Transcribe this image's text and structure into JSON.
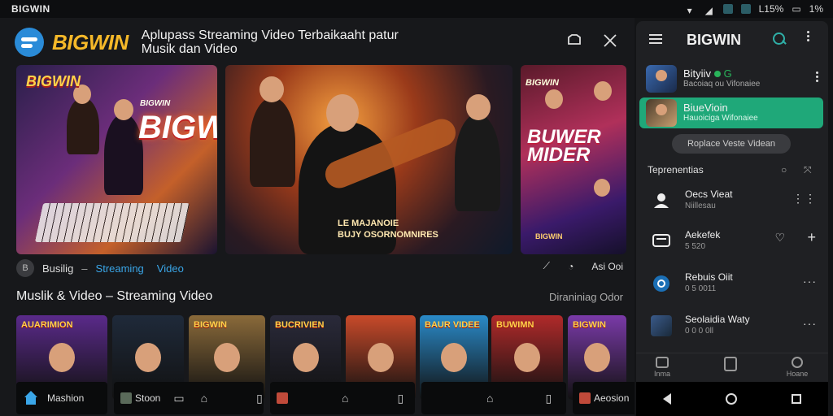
{
  "statusbar": {
    "left_label": "BIGWIN",
    "battery": "L15%",
    "signal": "1%"
  },
  "header": {
    "brand": "BIGWIN",
    "title": "Aplupass Streaming Video Terbaikaaht patur Musik dan Video"
  },
  "featured": [
    {
      "small_title": "BIGWIN",
      "sub": "BIGWIN",
      "big_title": "BIGWIN"
    },
    {
      "caption": "LE MAJANOIE\nBUJY OSORNOMNIRES"
    },
    {
      "top_title": "BIGWIN",
      "big_title": "BUWER\nMIDER",
      "footer": "BIGWIN"
    }
  ],
  "tags": {
    "icon_label": "B",
    "items": [
      "Busilig",
      "–",
      "Streaming",
      "Video"
    ],
    "right_label": "Asi Ooi"
  },
  "section": {
    "title": "Muslik & Video – Streaming Video",
    "more_label": "Diraniniag Odor"
  },
  "thumbnails": [
    {
      "label": "AUARIMION",
      "bg": "#5a2a8a"
    },
    {
      "label": "",
      "bg": "#1f2a3a"
    },
    {
      "label": "BIGWIN",
      "bg": "#8a6a3a"
    },
    {
      "label": "BUCRIVIEN",
      "bg": "#2a2a3a"
    },
    {
      "label": "",
      "bg": "#c84a2a"
    },
    {
      "label": "BAUR VIDEE",
      "bg": "#2a8ac8"
    },
    {
      "label": "BUWIMN",
      "bg": "#b02a2a"
    },
    {
      "label": "BIGWIN",
      "bg": "#7a3aa8"
    }
  ],
  "dock": [
    {
      "label": "Mashion"
    },
    {
      "label": "Stoon"
    },
    {
      "label": ""
    },
    {
      "label": "Aeosion"
    }
  ],
  "panel": {
    "brand": "BIGWIN",
    "channels": [
      {
        "name": "Bityiiv",
        "suffix": "G",
        "sub": "Bacoiaq ou Vifonaiee"
      },
      {
        "name": "BiueVioin",
        "sub": "Hauoiciga Wifonaiee"
      }
    ],
    "pill_label": "Roplace Veste Videan",
    "section_title": "Teprenentias",
    "rows": [
      {
        "name": "Oecs Vieat",
        "sub": "Niillesau",
        "action": "⋮⋮"
      },
      {
        "name": "Aekefek",
        "sub": "5 520",
        "action": "+"
      },
      {
        "name": "Rebuis Oiit",
        "sub": "0 5 0011",
        "action": "···"
      },
      {
        "name": "Seolaidia Waty",
        "sub": "0 0 0 0ll",
        "action": "···"
      }
    ],
    "tabs": [
      "Inma",
      "",
      "Hoane"
    ]
  },
  "colors": {
    "accent": "#1fa879",
    "brand_gold": "#f5b829",
    "link": "#3aa6e8"
  }
}
